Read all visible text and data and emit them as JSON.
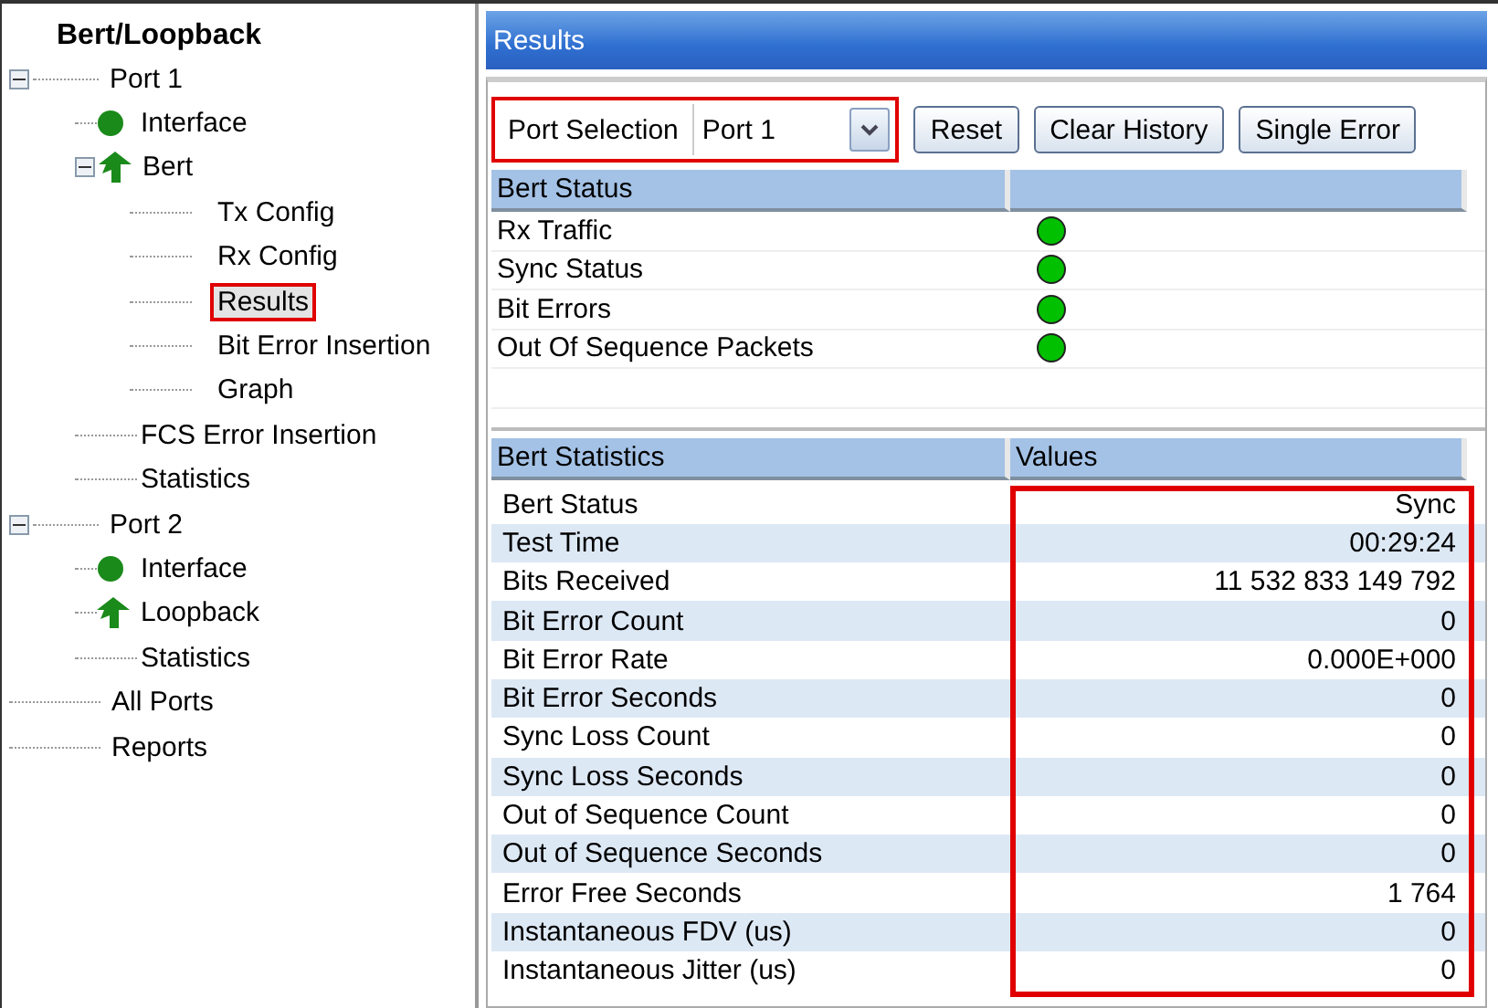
{
  "tree": {
    "title": "Bert/Loopback",
    "items": [
      {
        "label": "Port 1",
        "expanded": true,
        "selected": false,
        "children": [
          {
            "label": "Interface",
            "kind": "dot",
            "selected": false
          },
          {
            "label": "Bert",
            "kind": "arrow",
            "expanded": true,
            "selected": false,
            "children": [
              {
                "label": "Tx Config",
                "selected": false
              },
              {
                "label": "Rx Config",
                "selected": false
              },
              {
                "label": "Results",
                "selected": true
              },
              {
                "label": "Bit Error Insertion",
                "selected": false
              },
              {
                "label": "Graph",
                "selected": false
              }
            ]
          },
          {
            "label": "FCS Error Insertion",
            "selected": false
          },
          {
            "label": "Statistics",
            "selected": false
          }
        ]
      },
      {
        "label": "Port 2",
        "expanded": true,
        "selected": false,
        "children": [
          {
            "label": "Interface",
            "kind": "dot",
            "selected": false
          },
          {
            "label": "Loopback",
            "kind": "arrow",
            "selected": false
          },
          {
            "label": "Statistics",
            "selected": false
          }
        ]
      },
      {
        "label": "All Ports",
        "selected": false
      },
      {
        "label": "Reports",
        "selected": false
      }
    ]
  },
  "panel": {
    "title": "Results",
    "port_selection": {
      "label": "Port Selection",
      "value": "Port 1",
      "highlighted": true
    },
    "buttons": [
      "Reset",
      "Clear History",
      "Single Error"
    ],
    "status_table": {
      "columns": [
        "Bert Status"
      ],
      "rows": [
        {
          "name": "Rx Traffic",
          "color": "#00c000"
        },
        {
          "name": "Sync Status",
          "color": "#00c000"
        },
        {
          "name": "Bit Errors",
          "color": "#00c000"
        },
        {
          "name": "Out Of Sequence Packets",
          "color": "#00c000"
        }
      ]
    },
    "stats_table": {
      "columns": [
        "Bert Statistics",
        "Values"
      ],
      "values_highlighted": true,
      "rows": [
        {
          "name": "Bert Status",
          "value": "Sync"
        },
        {
          "name": "Test Time",
          "value": "00:29:24"
        },
        {
          "name": "Bits Received",
          "value": "11 532 833 149 792"
        },
        {
          "name": "Bit Error Count",
          "value": "0"
        },
        {
          "name": "Bit Error Rate",
          "value": "0.000E+000"
        },
        {
          "name": "Bit Error Seconds",
          "value": "0"
        },
        {
          "name": "Sync Loss Count",
          "value": "0"
        },
        {
          "name": "Sync Loss Seconds",
          "value": "0"
        },
        {
          "name": "Out of Sequence Count",
          "value": "0"
        },
        {
          "name": "Out of Sequence Seconds",
          "value": "0"
        },
        {
          "name": "Error Free Seconds",
          "value": "1 764"
        },
        {
          "name": "Instantaneous FDV (us)",
          "value": "0"
        },
        {
          "name": "Instantaneous Jitter (us)",
          "value": "0"
        }
      ]
    }
  }
}
